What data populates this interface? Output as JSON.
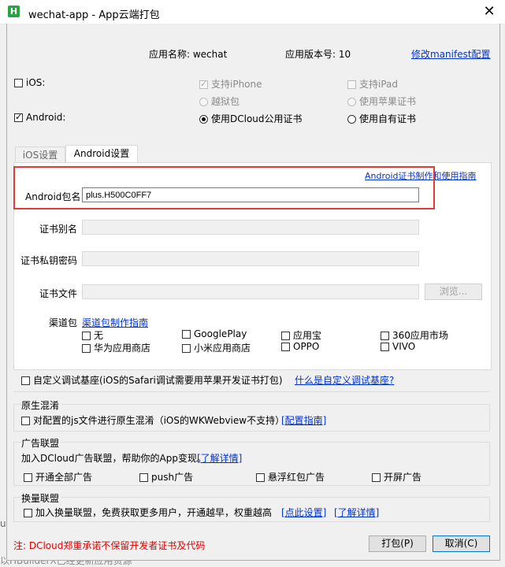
{
  "window": {
    "title": "wechat-app - App云端打包",
    "app_icon_letter": "H",
    "close_glyph": "✕"
  },
  "info": {
    "app_name_label": "应用名称: wechat",
    "app_version_label": "应用版本号: 10",
    "modify_manifest_link": "修改manifest配置"
  },
  "platforms": {
    "ios_label": "iOS:",
    "android_label": "Android:",
    "support_iphone": "支持iPhone",
    "support_ipad": "支持iPad",
    "jailbreak": "越狱包",
    "use_apple_cert": "使用苹果证书",
    "use_dcloud_cert": "使用DCloud公用证书",
    "use_own_cert": "使用自有证书"
  },
  "tabs": {
    "ios": "iOS设置",
    "android": "Android设置"
  },
  "android": {
    "cert_guide_link": "Android证书制作和使用指南",
    "package_label": "Android包名",
    "package_value": "plus.H500C0FF7",
    "alias_label": "证书别名",
    "key_password_label": "证书私钥密码",
    "cert_file_label": "证书文件",
    "browse_button": "浏览...",
    "channel_label": "渠道包",
    "channel_guide_link": "渠道包制作指南",
    "channels": [
      "无",
      "GooglePlay",
      "应用宝",
      "360应用市场",
      "华为应用商店",
      "小米应用商店",
      "OPPO",
      "VIVO"
    ]
  },
  "custom_base": {
    "label": "自定义调试基座(iOS的Safari调试需要用苹果开发证书打包)",
    "link": "什么是自定义调试基座?"
  },
  "obfuscation": {
    "title": "原生混淆",
    "label": "对配置的js文件进行原生混淆（iOS的WKWebview不支持）",
    "link": "[配置指南]"
  },
  "ads": {
    "title": "广告联盟",
    "description": "加入DCloud广告联盟，帮助你的App变现。",
    "link": "[了解详情]",
    "options": [
      "开通全部广告",
      "push广告",
      "悬浮红包广告",
      "开屏广告"
    ]
  },
  "exchange": {
    "title": "换量联盟",
    "label": "加入换量联盟，免费获取更多用户，开通越早，权重越高",
    "link_settings": "[点此设置]",
    "link_details": "[了解详情]"
  },
  "footer": {
    "note": "注: DCloud郑重承诺不保留开发者证书及代码",
    "pack_button": "打包(P)",
    "cancel_button": "取消(C)"
  },
  "background_text": {
    "left_char": "u",
    "bottom_text": "以HBuilderX已经更新应用资源"
  }
}
